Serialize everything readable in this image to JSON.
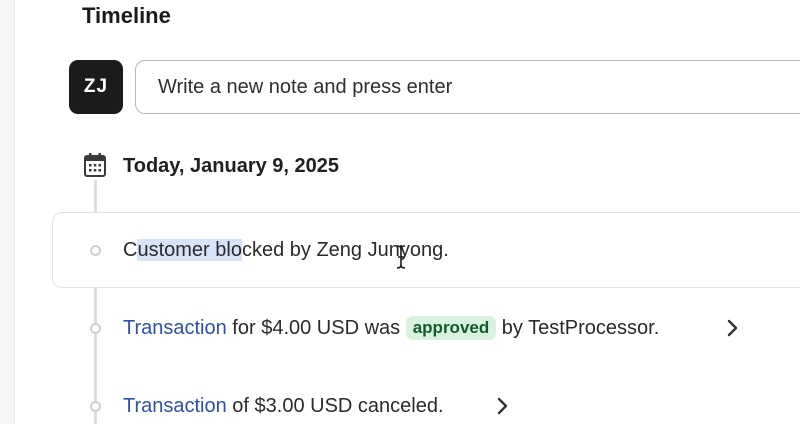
{
  "timeline": {
    "title": "Timeline"
  },
  "note": {
    "avatar_initials": "ZJ",
    "placeholder": "Write a new note and press enter"
  },
  "date_group": {
    "icon": "calendar-icon",
    "label": "Today, January 9, 2025"
  },
  "events": [
    {
      "highlight": "Customer blocked",
      "text_after": " by Zeng Junyong."
    },
    {
      "link": "Transaction",
      "text_before_badge": " for $4.00 USD was ",
      "badge": "approved",
      "text_after_badge": " by TestProcessor.",
      "badge_color": "#d9f2dd"
    },
    {
      "link": "Transaction",
      "text_after": " of $3.00 USD canceled."
    }
  ],
  "colors": {
    "link": "#2c4fb0",
    "avatar_bg": "#1b1b1b",
    "selection": "#d7e3f8"
  }
}
